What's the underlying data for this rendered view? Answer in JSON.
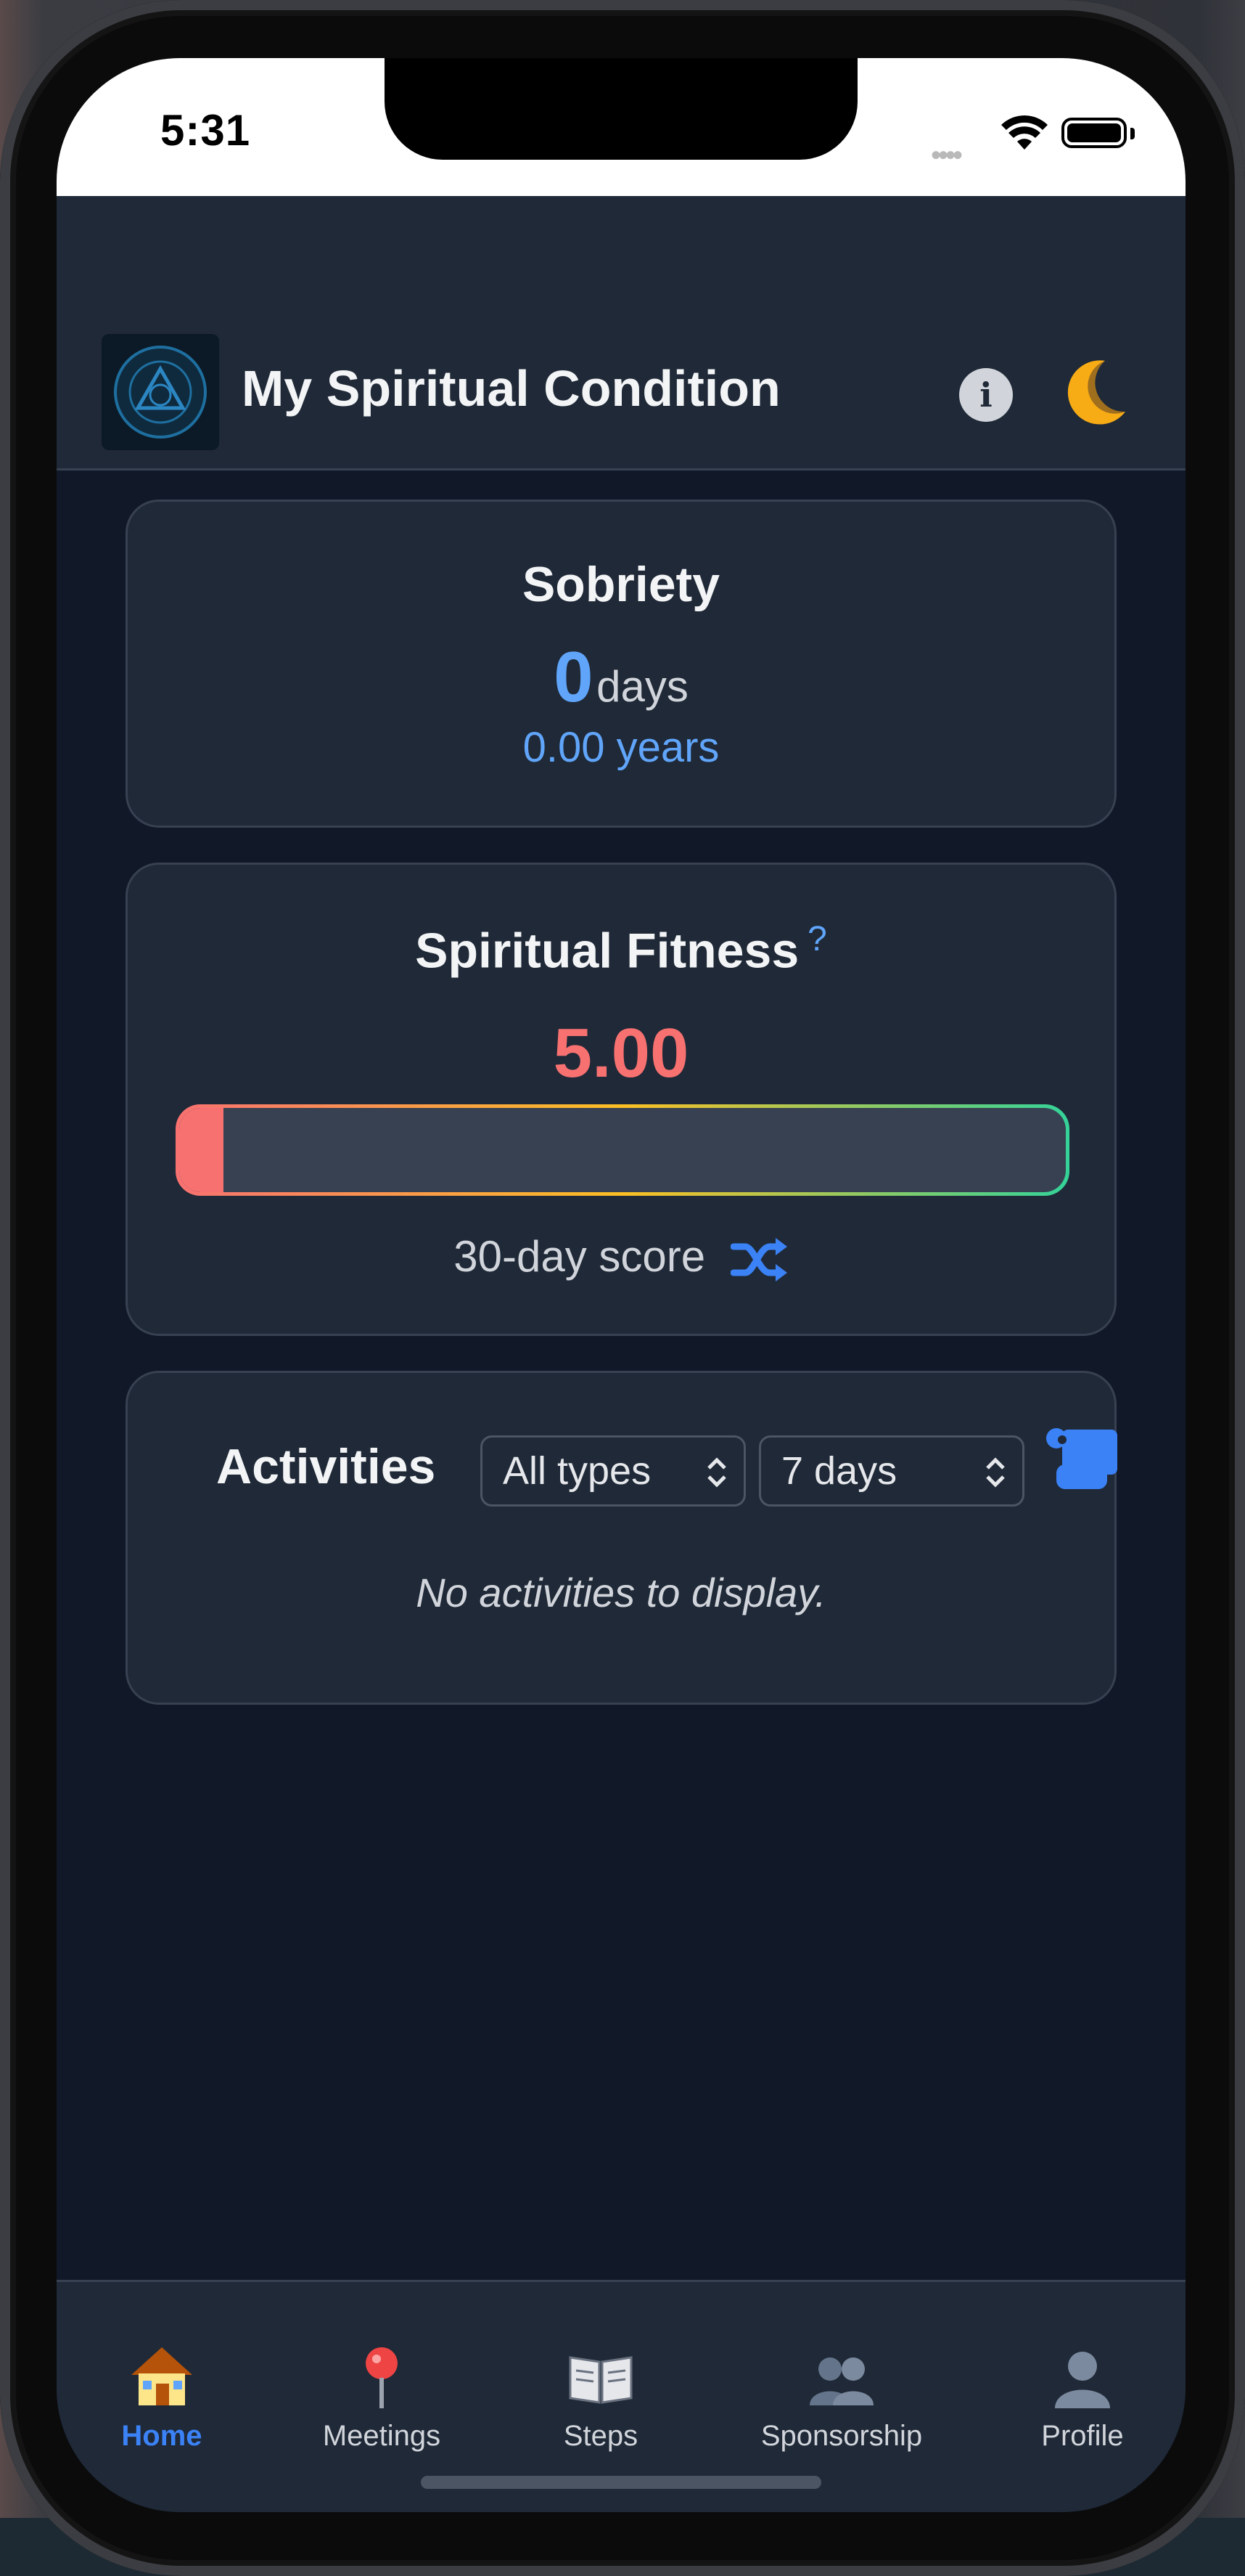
{
  "status": {
    "time": "5:31"
  },
  "header": {
    "title": "My Spiritual Condition",
    "logo_icon": "spiritual-condition-tracker-logo",
    "info_icon": "info-icon",
    "theme_icon": "moon-icon"
  },
  "sobriety": {
    "title": "Sobriety",
    "days": "0",
    "days_unit": "days",
    "years": "0.00 years"
  },
  "fitness": {
    "title": "Spiritual Fitness",
    "help": "?",
    "score": "5.00",
    "score_fraction": 0.05,
    "label": "30-day score",
    "shuffle_icon": "shuffle-icon"
  },
  "activities": {
    "title": "Activities",
    "type_filter": "All types",
    "range_filter": "7 days",
    "log_icon": "scroll-icon",
    "empty": "No activities to display."
  },
  "tabs": [
    {
      "label": "Home",
      "icon": "house-icon",
      "active": true
    },
    {
      "label": "Meetings",
      "icon": "pin-icon",
      "active": false
    },
    {
      "label": "Steps",
      "icon": "book-icon",
      "active": false
    },
    {
      "label": "Sponsorship",
      "icon": "people-icon",
      "active": false
    },
    {
      "label": "Profile",
      "icon": "person-icon",
      "active": false
    }
  ],
  "colors": {
    "accent": "#3b82f6",
    "score": "#f87171",
    "background": "#111827",
    "card": "#1f2937"
  }
}
